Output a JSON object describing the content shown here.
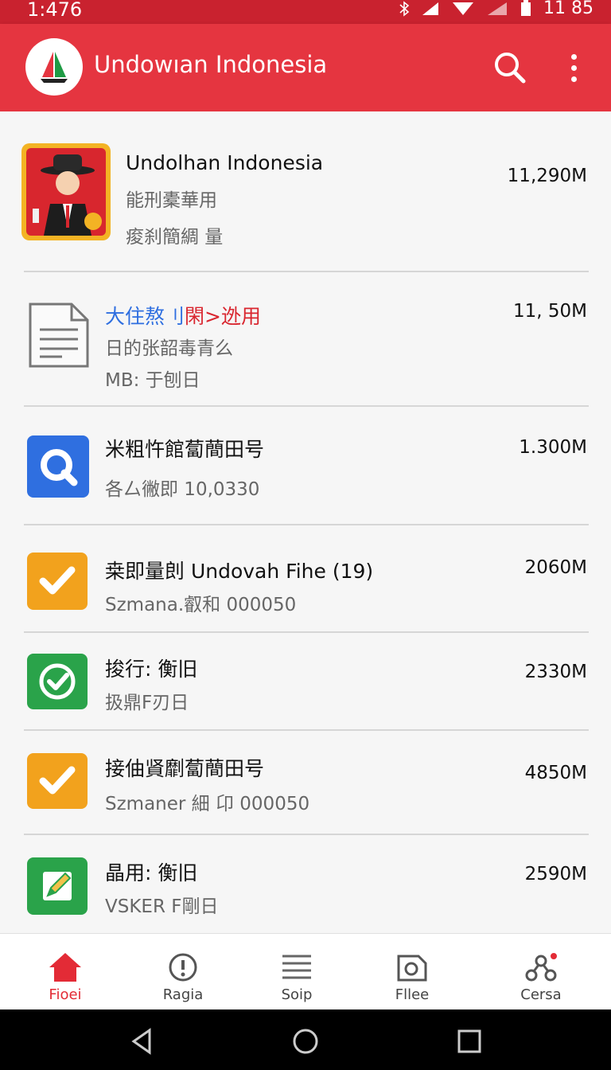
{
  "status_bar": {
    "time": "1:476",
    "clock_right": "11 85"
  },
  "app_bar": {
    "title": "Undowıan Indonesia"
  },
  "items": [
    {
      "title": "Undolhan Indonesia",
      "line2": "能刑橐華用",
      "line3": "痠刹簡綢 量",
      "size": "11,290M",
      "icon": "app-avatar-icon"
    },
    {
      "title_blue": "大住熬刂",
      "title_red": "閑>迯用",
      "line2": "日的张韶毒青么",
      "line3": "MB: 于刨日",
      "size": "11, 50M",
      "icon": "document-icon"
    },
    {
      "title": "米粗忤館蔔蕳田号",
      "line2": "各厶徶即 10,0330",
      "size": "1.300M",
      "icon": "magnifier-icon"
    },
    {
      "title": "桒即量剆 Undovah Fihe (19)",
      "line2": "Szmana.叡和 000050",
      "size": "2060M",
      "icon": "checkmark-icon"
    },
    {
      "title": "捘行: 衡旧",
      "line2": "扱鼎F刃日",
      "size": "2330M",
      "icon": "check-circle-icon"
    },
    {
      "title": "接伷䝨劘蔔蕳田号",
      "line2": "Szmaner 細 卬 000050",
      "size": "4850M",
      "icon": "checkmark-icon"
    },
    {
      "title": "晶用: 衡旧",
      "line2": "VSKER F剛日",
      "size": "2590M",
      "icon": "edit-note-icon"
    }
  ],
  "bottom_nav": [
    {
      "label": "Fioei",
      "icon": "home-icon",
      "active": true
    },
    {
      "label": "Ragia",
      "icon": "info-circle-icon",
      "active": false
    },
    {
      "label": "Soip",
      "icon": "list-lines-icon",
      "active": false
    },
    {
      "label": "Fllee",
      "icon": "photo-file-icon",
      "active": false
    },
    {
      "label": "Cersa",
      "icon": "network-icon",
      "active": false
    }
  ],
  "colors": {
    "primary": "#e53540",
    "status": "#c9222f",
    "accent_blue": "#2f6fe0",
    "accent_orange": "#f2a21d",
    "accent_green": "#2aa34a"
  }
}
